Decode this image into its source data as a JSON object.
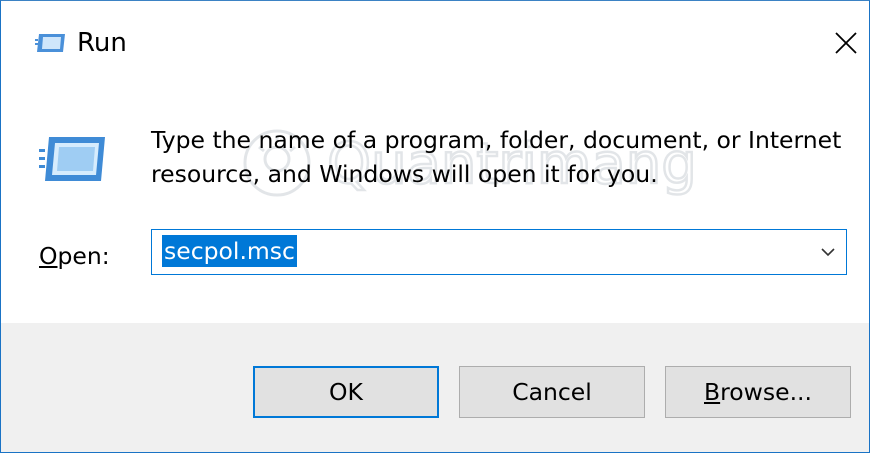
{
  "window": {
    "title": "Run",
    "title_icon": "run-icon",
    "close_icon": "close-icon",
    "border_color": "#0078d7"
  },
  "content": {
    "icon": "run-app-icon",
    "description": "Type the name of a program, folder, document, or Internet\nresource, and Windows will open it for you.",
    "open_label_mnemonic": "O",
    "open_label_rest": "pen:",
    "open_value": "secpol.msc",
    "dropdown_icon": "chevron-down-icon"
  },
  "buttons": {
    "ok_label": "OK",
    "cancel_label": "Cancel",
    "browse_mnemonic": "B",
    "browse_rest": "rowse..."
  },
  "watermark": {
    "text": "Quantrimang"
  },
  "colors": {
    "accent": "#0078d7",
    "footer_bg": "#f0f0f0",
    "button_bg": "#e1e1e1"
  }
}
